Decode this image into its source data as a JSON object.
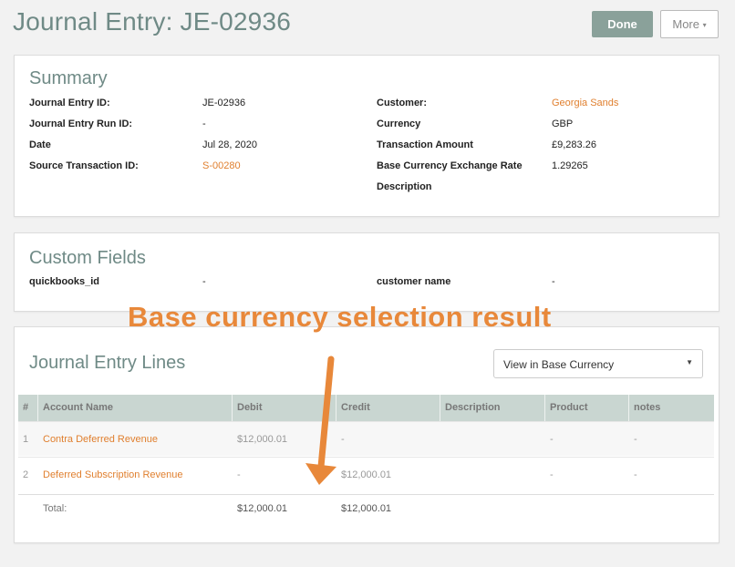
{
  "header": {
    "title": "Journal Entry: JE-02936",
    "done_label": "Done",
    "more_label": "More"
  },
  "summary": {
    "title": "Summary",
    "left": [
      {
        "label": "Journal Entry ID:",
        "value": "JE-02936"
      },
      {
        "label": "Journal Entry Run ID:",
        "value": "-"
      },
      {
        "label": "Date",
        "value": "Jul 28, 2020"
      },
      {
        "label": "Source Transaction ID:",
        "value": "S-00280"
      }
    ],
    "right": [
      {
        "label": "Customer:",
        "value": "Georgia Sands"
      },
      {
        "label": "Currency",
        "value": "GBP"
      },
      {
        "label": "Transaction Amount",
        "value": "£9,283.26"
      },
      {
        "label": "Base Currency Exchange Rate",
        "value": "1.29265"
      },
      {
        "label": "Description",
        "value": ""
      }
    ]
  },
  "custom_fields": {
    "title": "Custom Fields",
    "items": [
      {
        "label": "quickbooks_id",
        "value": "-"
      },
      {
        "label": "customer name",
        "value": "-"
      }
    ]
  },
  "annotation": "Base currency selection result",
  "lines": {
    "title": "Journal Entry Lines",
    "view_select": "View in Base Currency",
    "columns": [
      "#",
      "Account Name",
      "Debit",
      "Credit",
      "Description",
      "Product",
      "notes"
    ],
    "rows": [
      {
        "num": "1",
        "account": "Contra Deferred Revenue",
        "debit": "$12,000.01",
        "credit": "-",
        "description": "",
        "product": "-",
        "notes": "-"
      },
      {
        "num": "2",
        "account": "Deferred Subscription Revenue",
        "debit": "-",
        "credit": "$12,000.01",
        "description": "",
        "product": "-",
        "notes": "-"
      }
    ],
    "total": {
      "label": "Total:",
      "debit": "$12,000.01",
      "credit": "$12,000.01"
    }
  },
  "colors": {
    "title": "#6f8a86",
    "link": "#e07f2e",
    "annotation": "#e8883a",
    "done_button": "#8aa19a",
    "table_header": "#c9d6d1"
  }
}
